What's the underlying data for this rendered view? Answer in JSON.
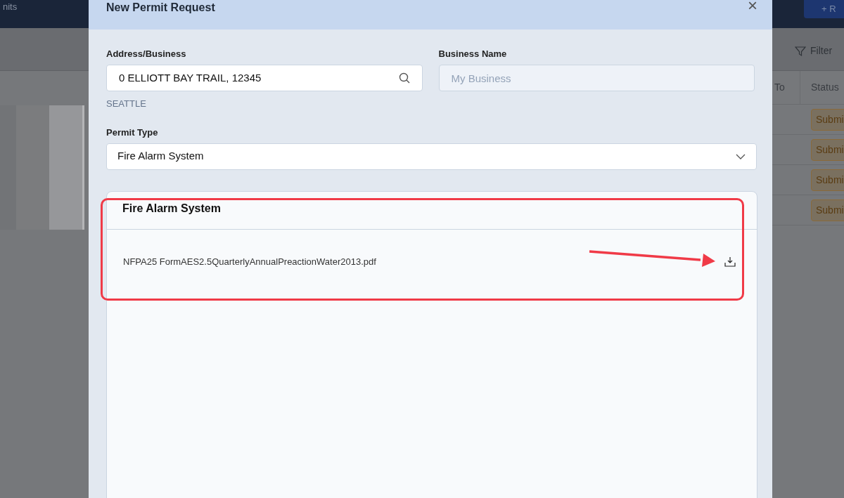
{
  "background": {
    "nav_text": "nits",
    "new_button": "+ R",
    "filter": "Filter",
    "columns": [
      "To",
      "Status"
    ],
    "rows": [
      {
        "status": "Submi"
      },
      {
        "status": "Submi"
      },
      {
        "status": "Submi"
      },
      {
        "status": "Submi"
      }
    ]
  },
  "modal": {
    "title": "New Permit Request",
    "close": "×",
    "address": {
      "label": "Address/Business",
      "value": "0 ELLIOTT BAY TRAIL, 12345",
      "hint": "SEATTLE"
    },
    "business_name": {
      "label": "Business Name",
      "placeholder": "My Business"
    },
    "permit_type": {
      "label": "Permit Type",
      "value": "Fire Alarm System"
    },
    "documents": {
      "title": "Fire Alarm System",
      "files": [
        {
          "name": "NFPA25 FormAES2.5QuarterlyAnnualPreactionWater2013.pdf"
        }
      ]
    }
  }
}
